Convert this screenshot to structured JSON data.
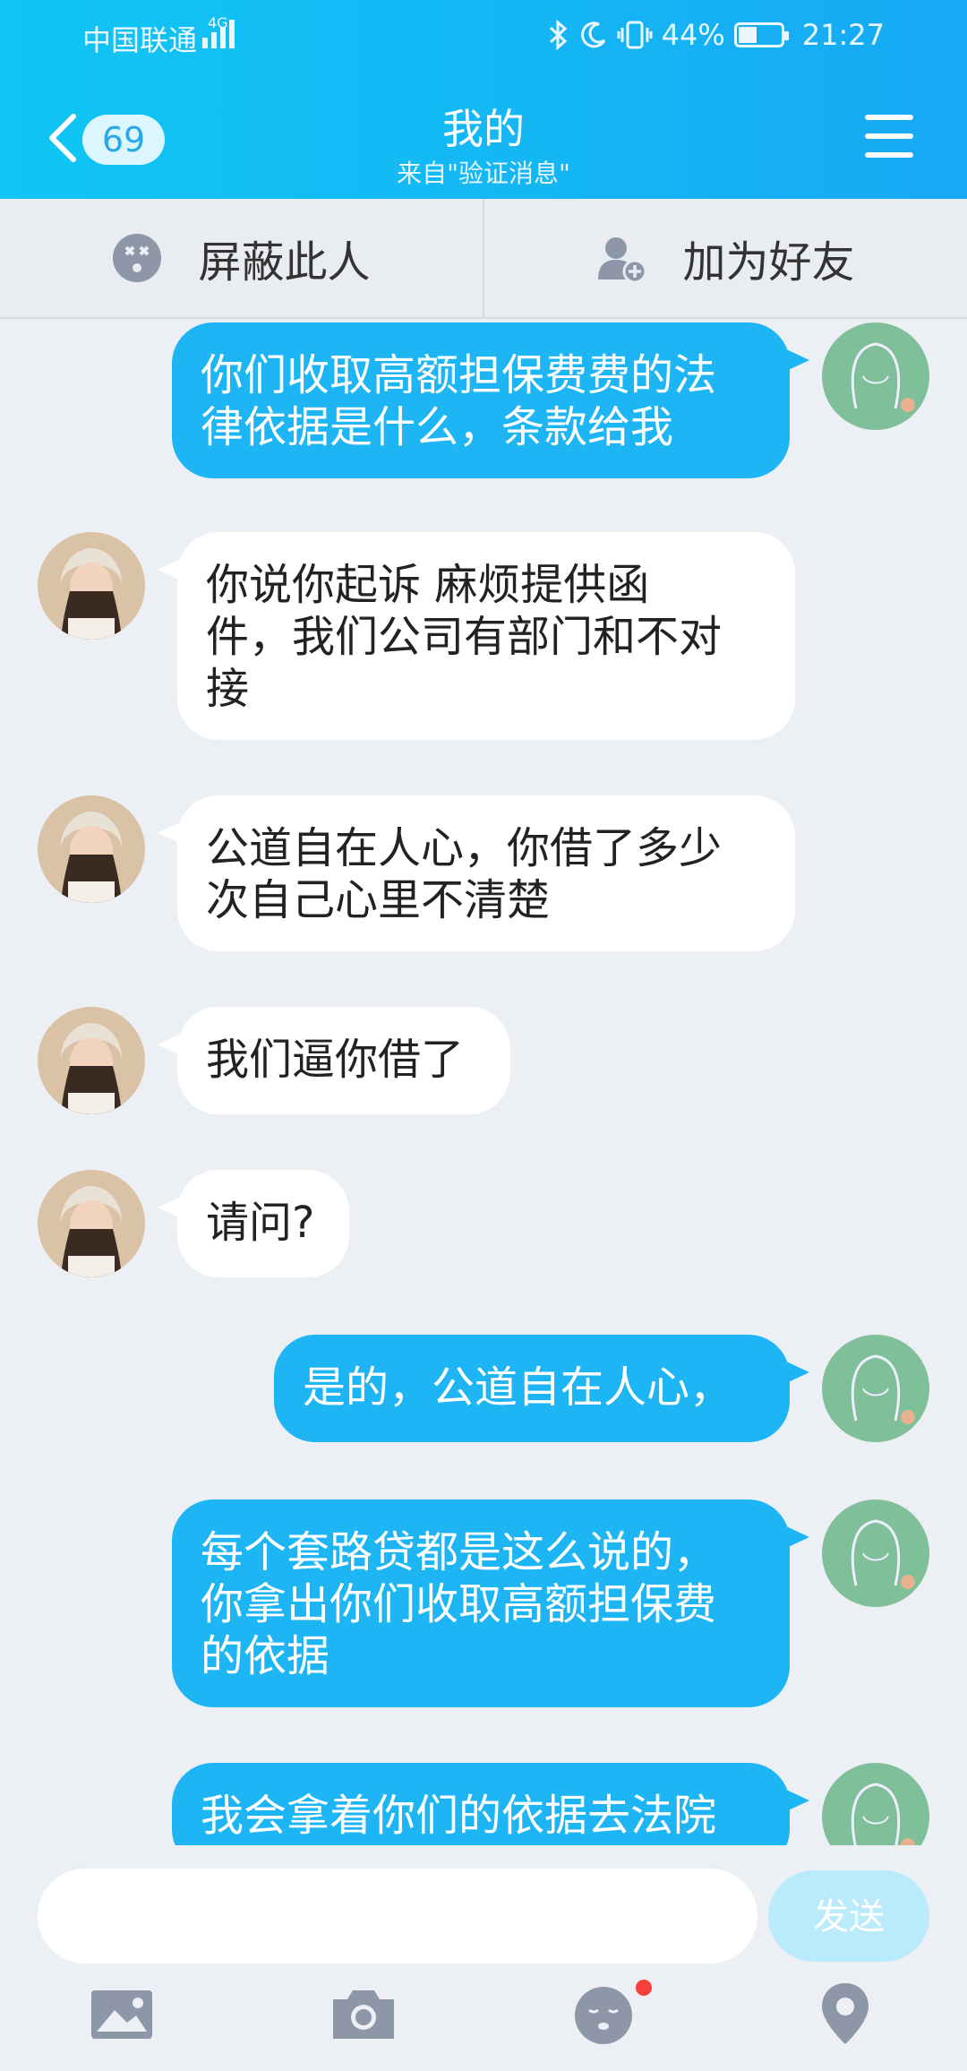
{
  "status_bar": {
    "carrier": "中国联通",
    "network": "4G",
    "battery_percent": "44%",
    "battery_level": 0.44,
    "time": "21:27"
  },
  "header": {
    "unread_count": "69",
    "title": "我的",
    "subtitle": "来自\"验证消息\""
  },
  "actions": {
    "block_label": "屏蔽此人",
    "add_friend_label": "加为好友"
  },
  "messages": [
    {
      "side": "sent",
      "lines": [
        "你们收取高额担保费费的法",
        "律依据是什么，条款给我"
      ]
    },
    {
      "side": "recv",
      "lines": [
        "你说你起诉 麻烦提供函",
        "件，我们公司有部门和不对",
        "接"
      ]
    },
    {
      "side": "recv",
      "lines": [
        "公道自在人心，你借了多少",
        "次自己心里不清楚"
      ]
    },
    {
      "side": "recv",
      "lines": [
        "我们逼你借了"
      ]
    },
    {
      "side": "recv",
      "lines": [
        "请问?"
      ]
    },
    {
      "side": "sent",
      "lines": [
        "是的，公道自在人心，"
      ]
    },
    {
      "side": "sent",
      "lines": [
        "每个套路贷都是这么说的，",
        "你拿出你们收取高额担保费",
        "的依据"
      ]
    },
    {
      "side": "sent",
      "lines": [
        "我会拿着你们的依据去法院"
      ]
    }
  ],
  "input": {
    "value": "",
    "send_label": "发送"
  },
  "toolbar": [
    "image-icon",
    "camera-icon",
    "emoji-icon",
    "location-icon"
  ],
  "colors": {
    "header_start": "#10c6f4",
    "header_end": "#17a9f4",
    "sent_bubble": "#1eb5f5",
    "send_button": "#b9ebfb",
    "notification_dot": "#f5413a"
  }
}
